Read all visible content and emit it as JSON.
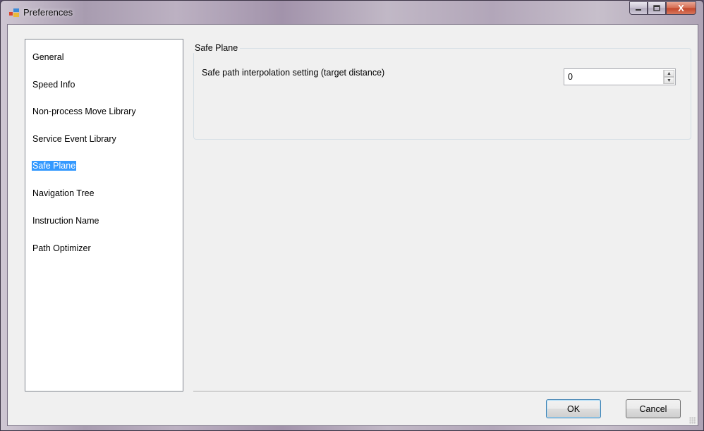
{
  "window": {
    "title": "Preferences",
    "icon": "preferences-app-icon",
    "controls": {
      "minimize": "minimize",
      "maximize": "maximize",
      "close": "X"
    }
  },
  "sidebar": {
    "items": [
      {
        "label": "General",
        "selected": false
      },
      {
        "label": "Speed Info",
        "selected": false
      },
      {
        "label": "Non-process Move Library",
        "selected": false
      },
      {
        "label": "Service Event Library",
        "selected": false
      },
      {
        "label": "Safe Plane",
        "selected": true
      },
      {
        "label": "Navigation Tree",
        "selected": false
      },
      {
        "label": "Instruction Name",
        "selected": false
      },
      {
        "label": "Path Optimizer",
        "selected": false
      }
    ]
  },
  "panel": {
    "group_title": "Safe Plane",
    "setting_label": "Safe path interpolation setting (target distance)",
    "setting_value": "0"
  },
  "footer": {
    "ok_label": "OK",
    "cancel_label": "Cancel"
  },
  "colors": {
    "selection": "#3399ff",
    "dialog_background": "#f0f0f0",
    "close_button": "#c2452a"
  }
}
